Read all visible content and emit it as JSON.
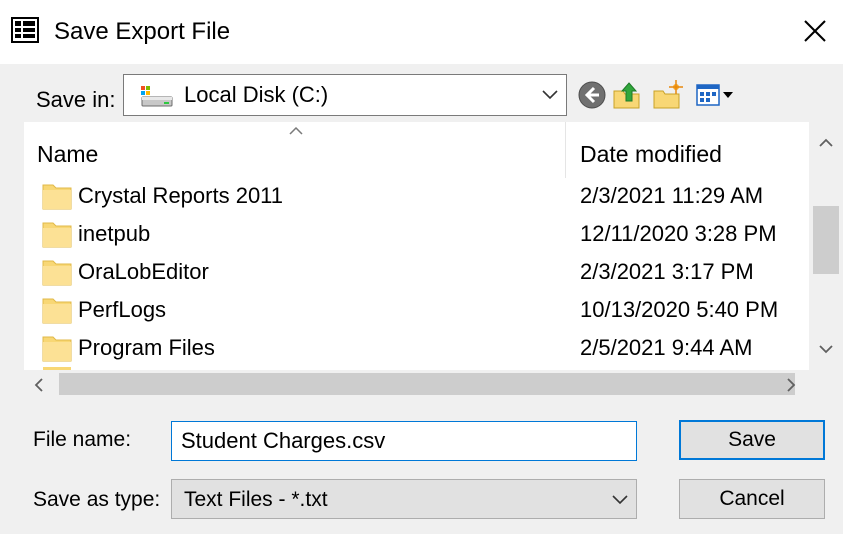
{
  "window": {
    "title": "Save Export File"
  },
  "save_in": {
    "label": "Save in:",
    "value": "Local Disk (C:)"
  },
  "toolbar": {
    "icons": [
      "back-icon",
      "up-folder-icon",
      "new-folder-icon",
      "view-menu-icon"
    ]
  },
  "file_list": {
    "columns": [
      "Name",
      "Date modified"
    ],
    "rows": [
      {
        "name": "Crystal Reports 2011",
        "date": "2/3/2021 11:29 AM"
      },
      {
        "name": "inetpub",
        "date": "12/11/2020 3:28 PM"
      },
      {
        "name": "OraLobEditor",
        "date": "2/3/2021 3:17 PM"
      },
      {
        "name": "PerfLogs",
        "date": "10/13/2020 5:40 PM"
      },
      {
        "name": "Program Files",
        "date": "2/5/2021 9:44 AM"
      }
    ]
  },
  "file_name": {
    "label": "File name:",
    "value": "Student Charges.csv"
  },
  "save_as_type": {
    "label": "Save as type:",
    "value": "Text Files - *.txt"
  },
  "buttons": {
    "save": "Save",
    "cancel": "Cancel"
  },
  "colors": {
    "accent": "#0078d7",
    "folder": "#f8d775",
    "dialog_bg": "#f0f0f0"
  }
}
